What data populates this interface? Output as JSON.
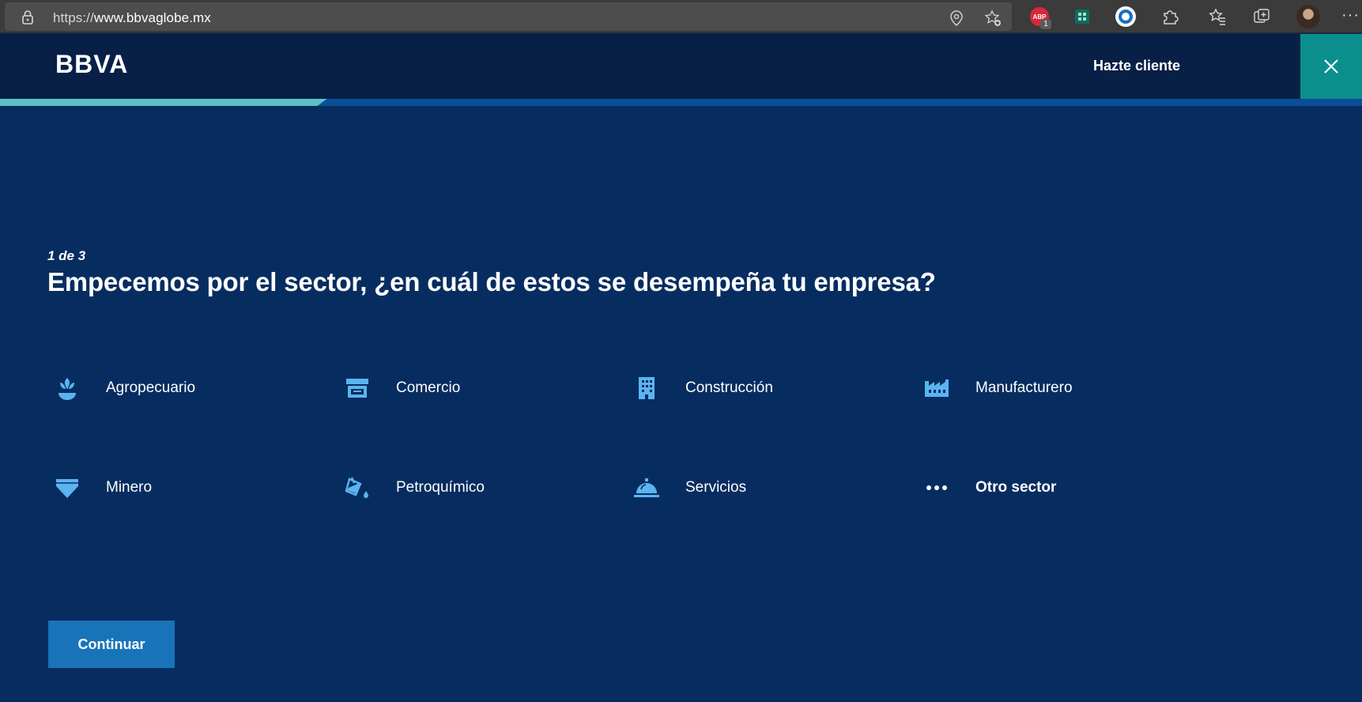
{
  "browser": {
    "url_scheme": "https://",
    "url_host": "www.bbvaglobe.mx",
    "extension_abp_label": "ABP",
    "extension_abp_count": "1"
  },
  "header": {
    "logo_text": "BBVA",
    "hazte_cliente": "Hazte cliente"
  },
  "progress": {
    "fraction": 0.24
  },
  "step_label": "1 de 3",
  "question": "Empecemos por el sector, ¿en cuál de estos se desempeña tu empresa?",
  "sectors": [
    {
      "label": "Agropecuario",
      "icon": "plant-icon"
    },
    {
      "label": "Comercio",
      "icon": "store-icon"
    },
    {
      "label": "Construcción",
      "icon": "building-icon"
    },
    {
      "label": "Manufacturero",
      "icon": "factory-icon"
    },
    {
      "label": "Minero",
      "icon": "gem-icon"
    },
    {
      "label": "Petroquímico",
      "icon": "paint-bucket-icon"
    },
    {
      "label": "Servicios",
      "icon": "service-bell-icon"
    },
    {
      "label": "Otro sector",
      "icon": "more-dots-icon"
    }
  ],
  "continue_label": "Continuar",
  "colors": {
    "page_bg": "#072d60",
    "header_bg": "#082046",
    "close_bg": "#0b8f8c",
    "progress_fill": "#5bc2c5",
    "icon_blue": "#5bb4f0",
    "button_bg": "#1973b8"
  }
}
